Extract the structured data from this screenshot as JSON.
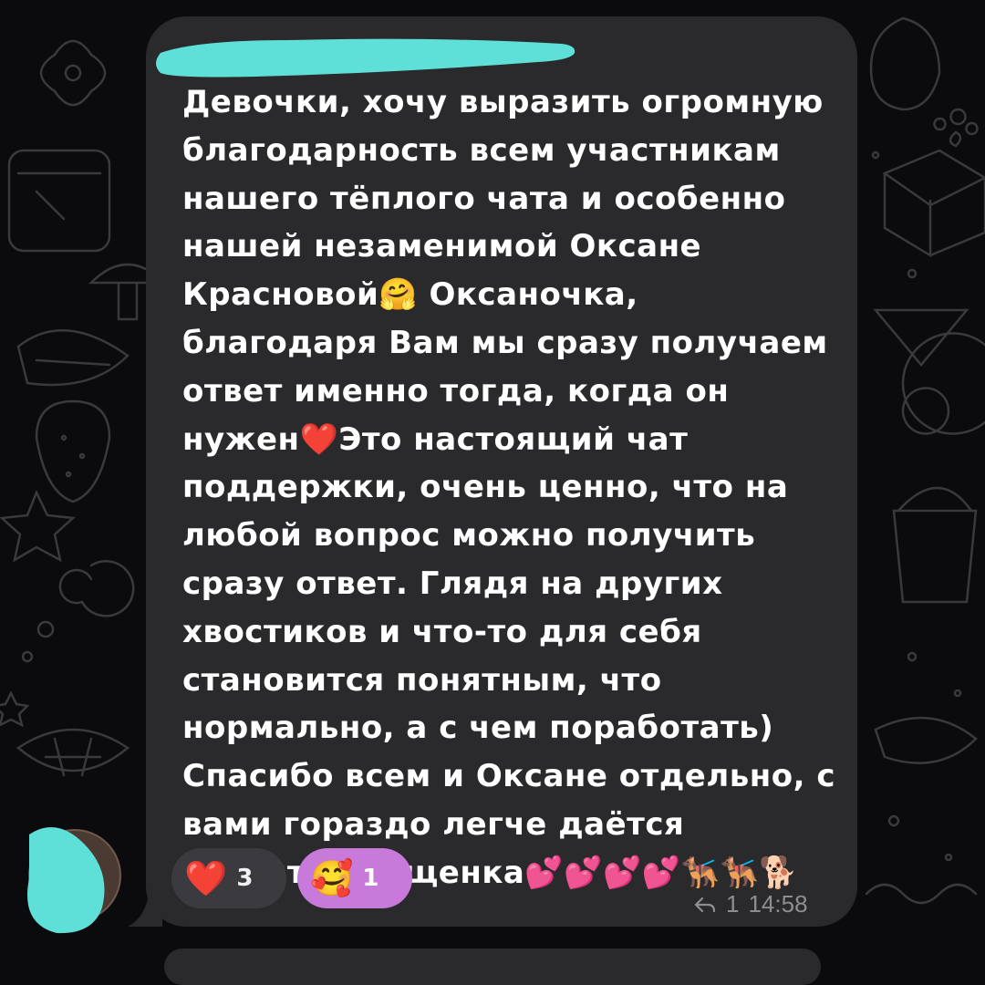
{
  "message": {
    "sender": "",
    "text": "Девочки, хочу выразить огромную благодарность всем участникам нашего тёплого чата и особенно нашей незаменимой Оксане Красновой🤗 Оксаночка, благодаря Вам мы сразу получаем ответ именно тогда, когда он нужен❤️Это настоящий чат поддержки, очень ценно, что на любой вопрос можно получить сразу ответ. Глядя на других хвостиков и что-то для себя становится понятным, что нормально, а с чем поработать) Спасибо всем и Оксане отдельно, с вами гораздо легче даётся воспитание щенка💕💕💕💕🐕‍🦺🐕‍🦺🐕",
    "reply_count": "1",
    "time": "14:58",
    "reply_icon": "reply-arrow-icon"
  },
  "reactions": [
    {
      "emoji": "❤️",
      "count": "3",
      "icon": "red-heart-icon"
    },
    {
      "emoji": "🥰",
      "count": "1",
      "icon": "smiling-face-with-hearts-icon"
    }
  ],
  "colors": {
    "background": "#0b0b0d",
    "bubble": "#2a2a2d",
    "text": "#ffffff",
    "meta": "#8d8d92",
    "reaction_default": "#3b3b3f",
    "reaction_chosen": "#c77ad9",
    "redaction": "#5ee0d8"
  }
}
